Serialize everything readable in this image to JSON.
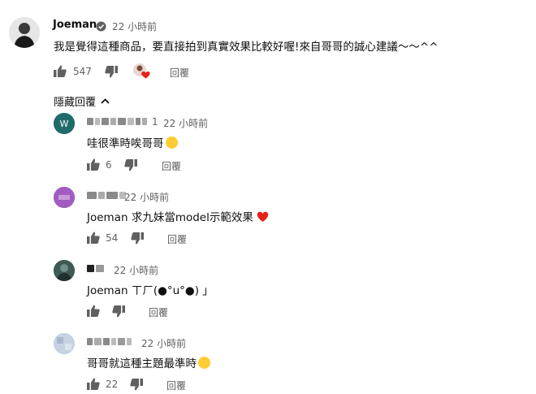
{
  "top_comment": {
    "author": "Joeman",
    "time": "22 小時前",
    "text": "我是覺得這種商品，要直接拍到真實效果比較好喔!來自哥哥的誠心建議～～^^",
    "likes": "547",
    "reply_label": "回覆"
  },
  "hide_replies_label": "隱藏回覆",
  "replies": [
    {
      "author_suffix": "1",
      "time": "22 小時前",
      "text": "哇很準時唉哥哥",
      "likes": "6",
      "reply_label": "回覆",
      "avatar_color": "#1f6b6b",
      "avatar_letter": "W"
    },
    {
      "author_suffix": "",
      "time": "22 小時前",
      "text": "Joeman 求九妹當model示範效果",
      "likes": "54",
      "reply_label": "回覆",
      "avatar_color": "#9b59b6"
    },
    {
      "author_suffix": "",
      "time": "22 小時前",
      "text": "Joeman ㄒㄏ(●°u°●) 」",
      "likes": "",
      "reply_label": "回覆",
      "avatar_color": "#4a5f5a"
    },
    {
      "author_suffix": "",
      "time": "22 小時前",
      "text": "哥哥就這種主題最準時",
      "likes": "22",
      "reply_label": "回覆",
      "avatar_color": "#b9c6d8"
    }
  ],
  "colors": {
    "heart": "#e62117",
    "icon_gray": "#606060",
    "verified": "#606060"
  }
}
